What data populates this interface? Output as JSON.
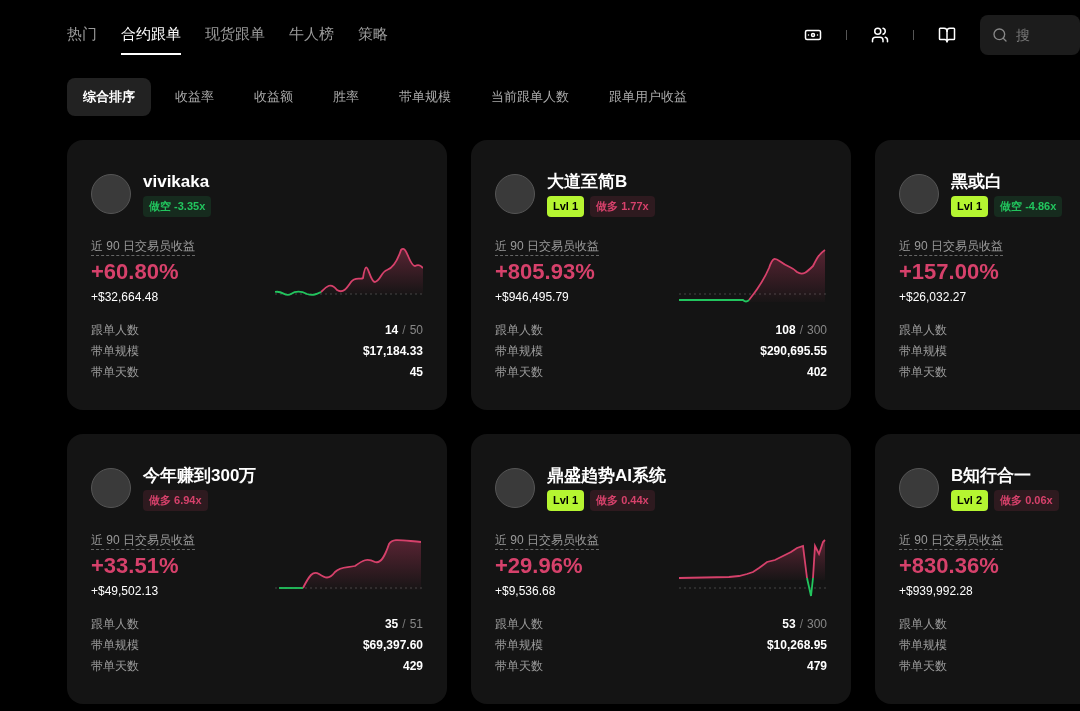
{
  "nav": {
    "tabs": [
      {
        "label": "热门",
        "selected": false
      },
      {
        "label": "合约跟单",
        "selected": true
      },
      {
        "label": "现货跟单",
        "selected": false
      },
      {
        "label": "牛人榜",
        "selected": false
      },
      {
        "label": "策略",
        "selected": false
      }
    ],
    "search": {
      "placeholder": "搜"
    }
  },
  "filters": [
    {
      "label": "综合排序",
      "selected": true
    },
    {
      "label": "收益率",
      "selected": false
    },
    {
      "label": "收益额",
      "selected": false
    },
    {
      "label": "胜率",
      "selected": false
    },
    {
      "label": "带单规模",
      "selected": false
    },
    {
      "label": "当前跟单人数",
      "selected": false
    },
    {
      "label": "跟单用户收益",
      "selected": false
    }
  ],
  "cards": [
    {
      "name": "vivikaka",
      "color": "#22c55e",
      "direction": "做空 -3.35x",
      "metric_label": "近 90 日交易员收益",
      "roi": "+60.80%",
      "pnl": "+$32,664.48",
      "stats": [
        {
          "label": "跟单人数",
          "value": "14",
          "separator": "/",
          "limit": "50"
        },
        {
          "label": "带单规模",
          "value": "$17,184.33"
        },
        {
          "label": "带单天数",
          "value": "45"
        }
      ]
    },
    {
      "name": "大道至简B",
      "level": "Lvl 1",
      "color": "#d6416b",
      "direction": "做多 1.77x",
      "metric_label": "近 90 日交易员收益",
      "roi": "+805.93%",
      "pnl": "+$946,495.79",
      "stats": [
        {
          "label": "跟单人数",
          "value": "108",
          "separator": "/",
          "limit": "300"
        },
        {
          "label": "带单规模",
          "value": "$290,695.55"
        },
        {
          "label": "带单天数",
          "value": "402"
        }
      ]
    },
    {
      "name": "黑或白",
      "level": "Lvl 1",
      "color": "#22c55e",
      "direction": "做空 -4.86x",
      "metric_label": "近 90 日交易员收益",
      "roi": "+157.00%",
      "pnl": "+$26,032.27",
      "stats": [
        {
          "label": "跟单人数"
        },
        {
          "label": "带单规模"
        },
        {
          "label": "带单天数"
        }
      ]
    },
    {
      "name": "今年赚到300万",
      "color": "#d6416b",
      "direction": "做多 6.94x",
      "metric_label": "近 90 日交易员收益",
      "roi": "+33.51%",
      "pnl": "+$49,502.13",
      "stats": [
        {
          "label": "跟单人数",
          "value": "35",
          "separator": "/",
          "limit": "51"
        },
        {
          "label": "带单规模",
          "value": "$69,397.60"
        },
        {
          "label": "带单天数",
          "value": "429"
        }
      ]
    },
    {
      "name": "鼎盛趋势AI系统",
      "level": "Lvl 1",
      "color": "#d6416b",
      "direction": "做多 0.44x",
      "metric_label": "近 90 日交易员收益",
      "roi": "+29.96%",
      "pnl": "+$9,536.68",
      "stats": [
        {
          "label": "跟单人数",
          "value": "53",
          "separator": "/",
          "limit": "300"
        },
        {
          "label": "带单规模",
          "value": "$10,268.95"
        },
        {
          "label": "带单天数",
          "value": "479"
        }
      ]
    },
    {
      "name": "B知行合一",
      "level": "Lvl 2",
      "color": "#d6416b",
      "direction": "做多 0.06x",
      "metric_label": "近 90 日交易员收益",
      "roi": "+830.36%",
      "pnl": "+$939,992.28",
      "stats": [
        {
          "label": "跟单人数"
        },
        {
          "label": "带单规模"
        },
        {
          "label": "带单天数"
        }
      ]
    }
  ]
}
